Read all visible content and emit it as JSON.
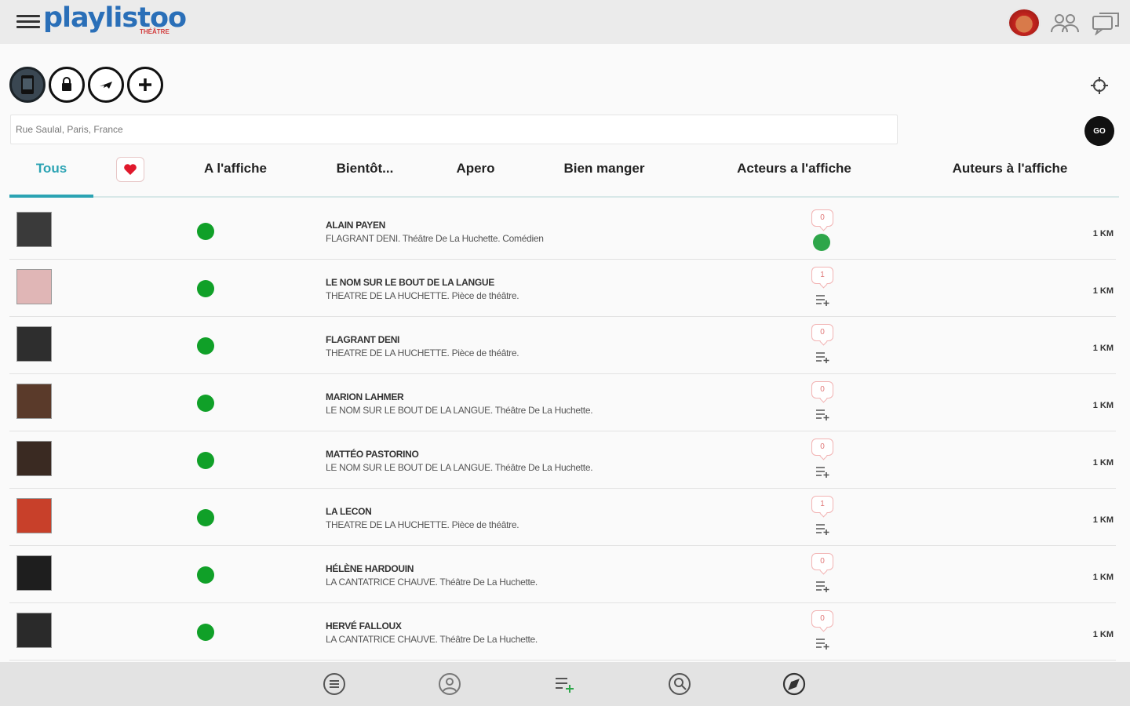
{
  "app": {
    "logo_main": "playlistoo",
    "logo_sub": "THÉÂTRE"
  },
  "toolbar": {
    "filter_icons": [
      "phone-icon",
      "lock-icon",
      "plane-icon",
      "plus-icon"
    ]
  },
  "search": {
    "value": "Rue Saulal, Paris, France",
    "go_label": "GO"
  },
  "tabs": [
    {
      "label": "Tous"
    },
    {
      "label": "A l'affiche"
    },
    {
      "label": "Bientôt..."
    },
    {
      "label": "Apero"
    },
    {
      "label": "Bien manger"
    },
    {
      "label": "Acteurs a l'affiche"
    },
    {
      "label": "Auteurs à l'affiche"
    }
  ],
  "items": [
    {
      "title": "ALAIN PAYEN",
      "subtitle": "FLAGRANT DENI. Théâtre De La Huchette. Comédien",
      "count": "0",
      "distance": "1 KM",
      "thumb_color": "#3a3a3a"
    },
    {
      "title": "LE NOM SUR LE BOUT DE LA LANGUE",
      "subtitle": "THEATRE DE LA HUCHETTE. Pièce de théâtre.",
      "count": "1",
      "distance": "1 KM",
      "thumb_color": "#e0b6b6"
    },
    {
      "title": "FLAGRANT DENI",
      "subtitle": "THEATRE DE LA HUCHETTE. Pièce de théâtre.",
      "count": "0",
      "distance": "1 KM",
      "thumb_color": "#2e2e2e"
    },
    {
      "title": "MARION LAHMER",
      "subtitle": "LE NOM SUR LE BOUT DE LA LANGUE. Théâtre De La Huchette.",
      "count": "0",
      "distance": "1 KM",
      "thumb_color": "#5a3a2a"
    },
    {
      "title": "MATTÉO PASTORINO",
      "subtitle": "LE NOM SUR LE BOUT DE LA LANGUE. Théâtre De La Huchette.",
      "count": "0",
      "distance": "1 KM",
      "thumb_color": "#3a2a22"
    },
    {
      "title": "LA LECON",
      "subtitle": "THEATRE DE LA HUCHETTE. Pièce de théâtre.",
      "count": "1",
      "distance": "1 KM",
      "thumb_color": "#c8402a"
    },
    {
      "title": "HÉLÈNE HARDOUIN",
      "subtitle": "LA CANTATRICE CHAUVE. Théâtre De La Huchette.",
      "count": "0",
      "distance": "1 KM",
      "thumb_color": "#1e1e1e"
    },
    {
      "title": "HERVÉ FALLOUX",
      "subtitle": "LA CANTATRICE CHAUVE. Théâtre De La Huchette.",
      "count": "0",
      "distance": "1 KM",
      "thumb_color": "#2a2a2a"
    }
  ],
  "colors": {
    "accent": "#2ba3b3",
    "status_green": "#10a028",
    "brand_blue": "#2a6fb8"
  },
  "bottom_nav": [
    "menu-circle-icon",
    "globe-icon",
    "playlist-add-icon",
    "search-circle-icon",
    "compass-icon"
  ]
}
